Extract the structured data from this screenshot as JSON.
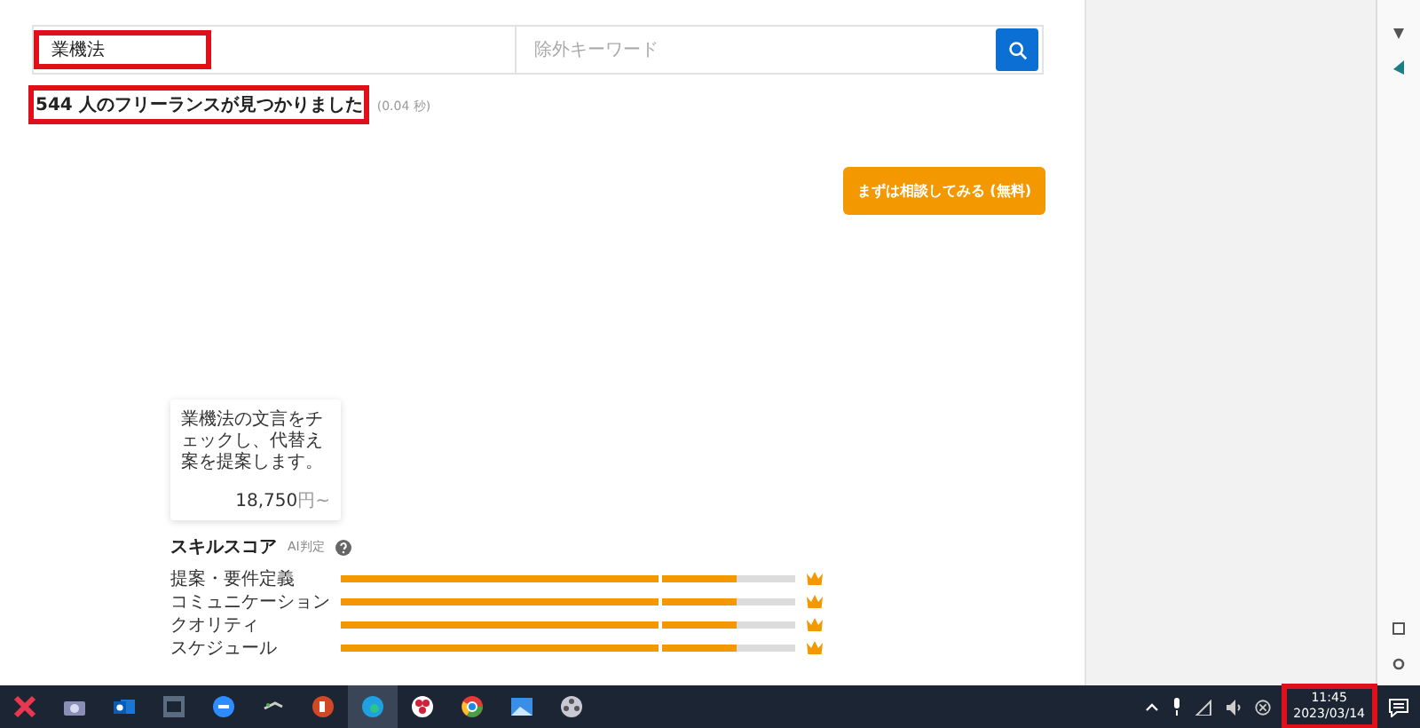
{
  "search": {
    "keyword": {
      "value": "業機法",
      "highlighted": true
    },
    "exclude": {
      "placeholder": "除外キーワード"
    }
  },
  "results": {
    "count_text": "544 人のフリーランスが見つかりました",
    "time": "(0.04 秒)",
    "highlighted": true
  },
  "cta_button": "まずは相談してみる (無料)",
  "card": {
    "description": "業機法の文言をチェックし、代替え案を提案します。",
    "price": "18,750",
    "unit": "円~"
  },
  "skill_score": {
    "title": "スキルスコア",
    "badge": "AI判定",
    "items": [
      {
        "label": "提案・要件定義",
        "level": 0.87
      },
      {
        "label": "コミュニケーション",
        "level": 0.87
      },
      {
        "label": "クオリティ",
        "level": 0.87
      },
      {
        "label": "スケジュール",
        "level": 0.87
      }
    ]
  },
  "taskbar": {
    "apps": [
      {
        "kind": "x",
        "selected": false
      },
      {
        "kind": "camera",
        "selected": false
      },
      {
        "kind": "mail",
        "selected": false
      },
      {
        "kind": "window",
        "selected": false
      },
      {
        "kind": "chat",
        "selected": false
      },
      {
        "kind": "tool",
        "selected": false
      },
      {
        "kind": "slides",
        "selected": false
      },
      {
        "kind": "browser",
        "selected": true
      },
      {
        "kind": "flower",
        "selected": false
      },
      {
        "kind": "globe",
        "selected": false
      },
      {
        "kind": "photo",
        "selected": false
      },
      {
        "kind": "film",
        "selected": false
      }
    ],
    "clock": {
      "time": "11:45",
      "date": "2023/03/14",
      "highlighted": true
    }
  }
}
